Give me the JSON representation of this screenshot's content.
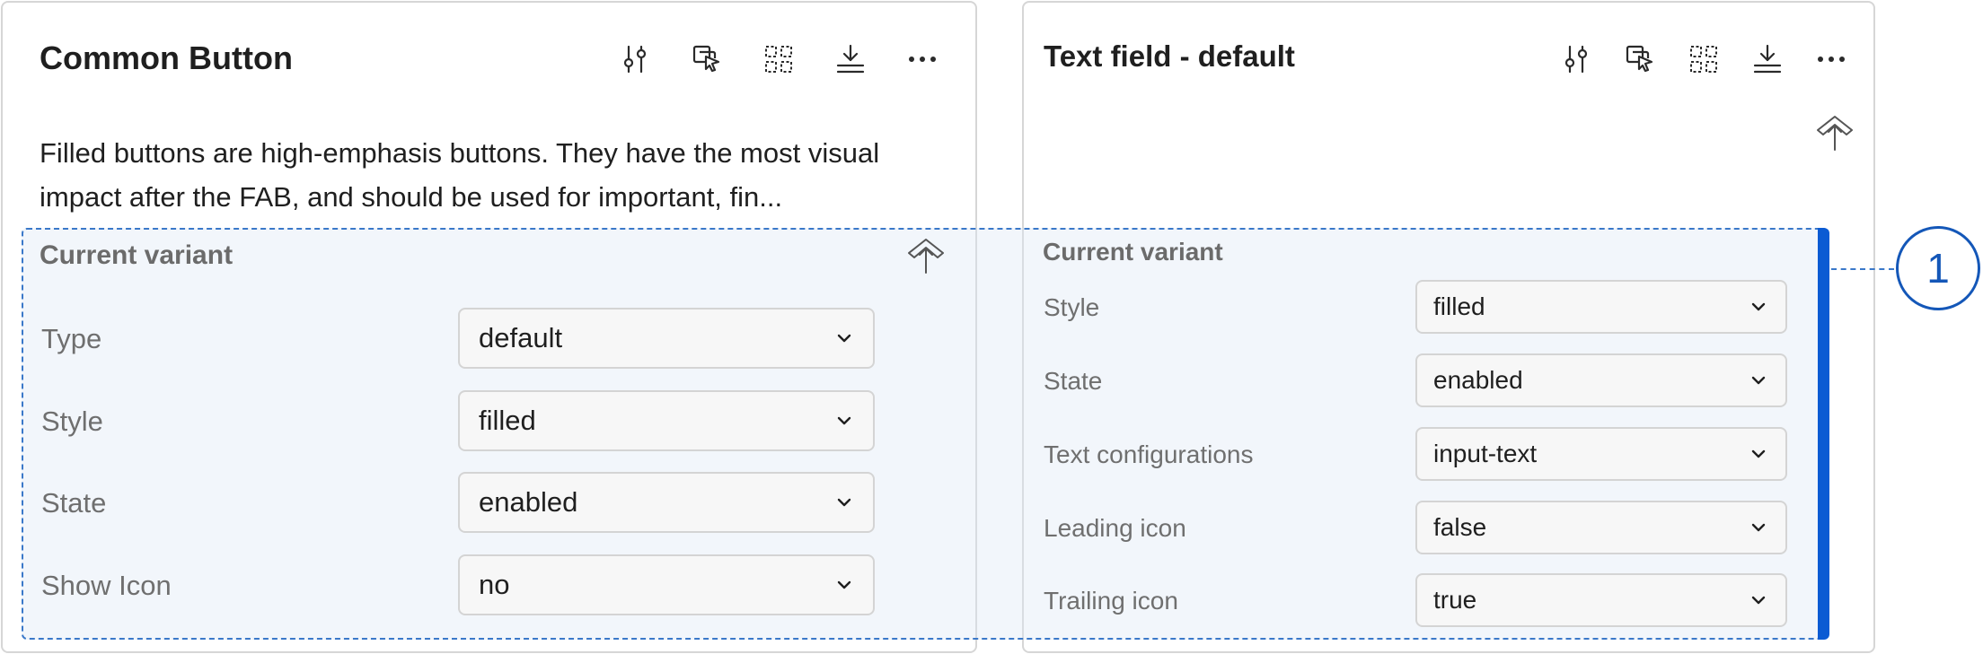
{
  "left_card": {
    "title": "Common Button",
    "description": "Filled buttons are high-emphasis buttons. They have the most visual impact after the FAB, and should be used for important, fin...",
    "section_title": "Current variant",
    "properties": [
      {
        "label": "Type",
        "value": "default"
      },
      {
        "label": "Style",
        "value": "filled"
      },
      {
        "label": "State",
        "value": "enabled"
      },
      {
        "label": "Show Icon",
        "value": "no"
      }
    ]
  },
  "right_card": {
    "title": "Text field - default",
    "section_title": "Current variant",
    "properties": [
      {
        "label": "Style",
        "value": "filled"
      },
      {
        "label": "State",
        "value": "enabled"
      },
      {
        "label": "Text configurations",
        "value": "input-text"
      },
      {
        "label": "Leading icon",
        "value": "false"
      },
      {
        "label": "Trailing icon",
        "value": "true"
      }
    ]
  },
  "toolbar_icons": [
    "sliders-icon",
    "cursor-copy-icon",
    "dashed-grid-icon",
    "download-icon",
    "more-icon"
  ],
  "callout": {
    "number": "1"
  },
  "colors": {
    "accent": "#0b5bd3",
    "highlight_border": "#3a78c9"
  }
}
